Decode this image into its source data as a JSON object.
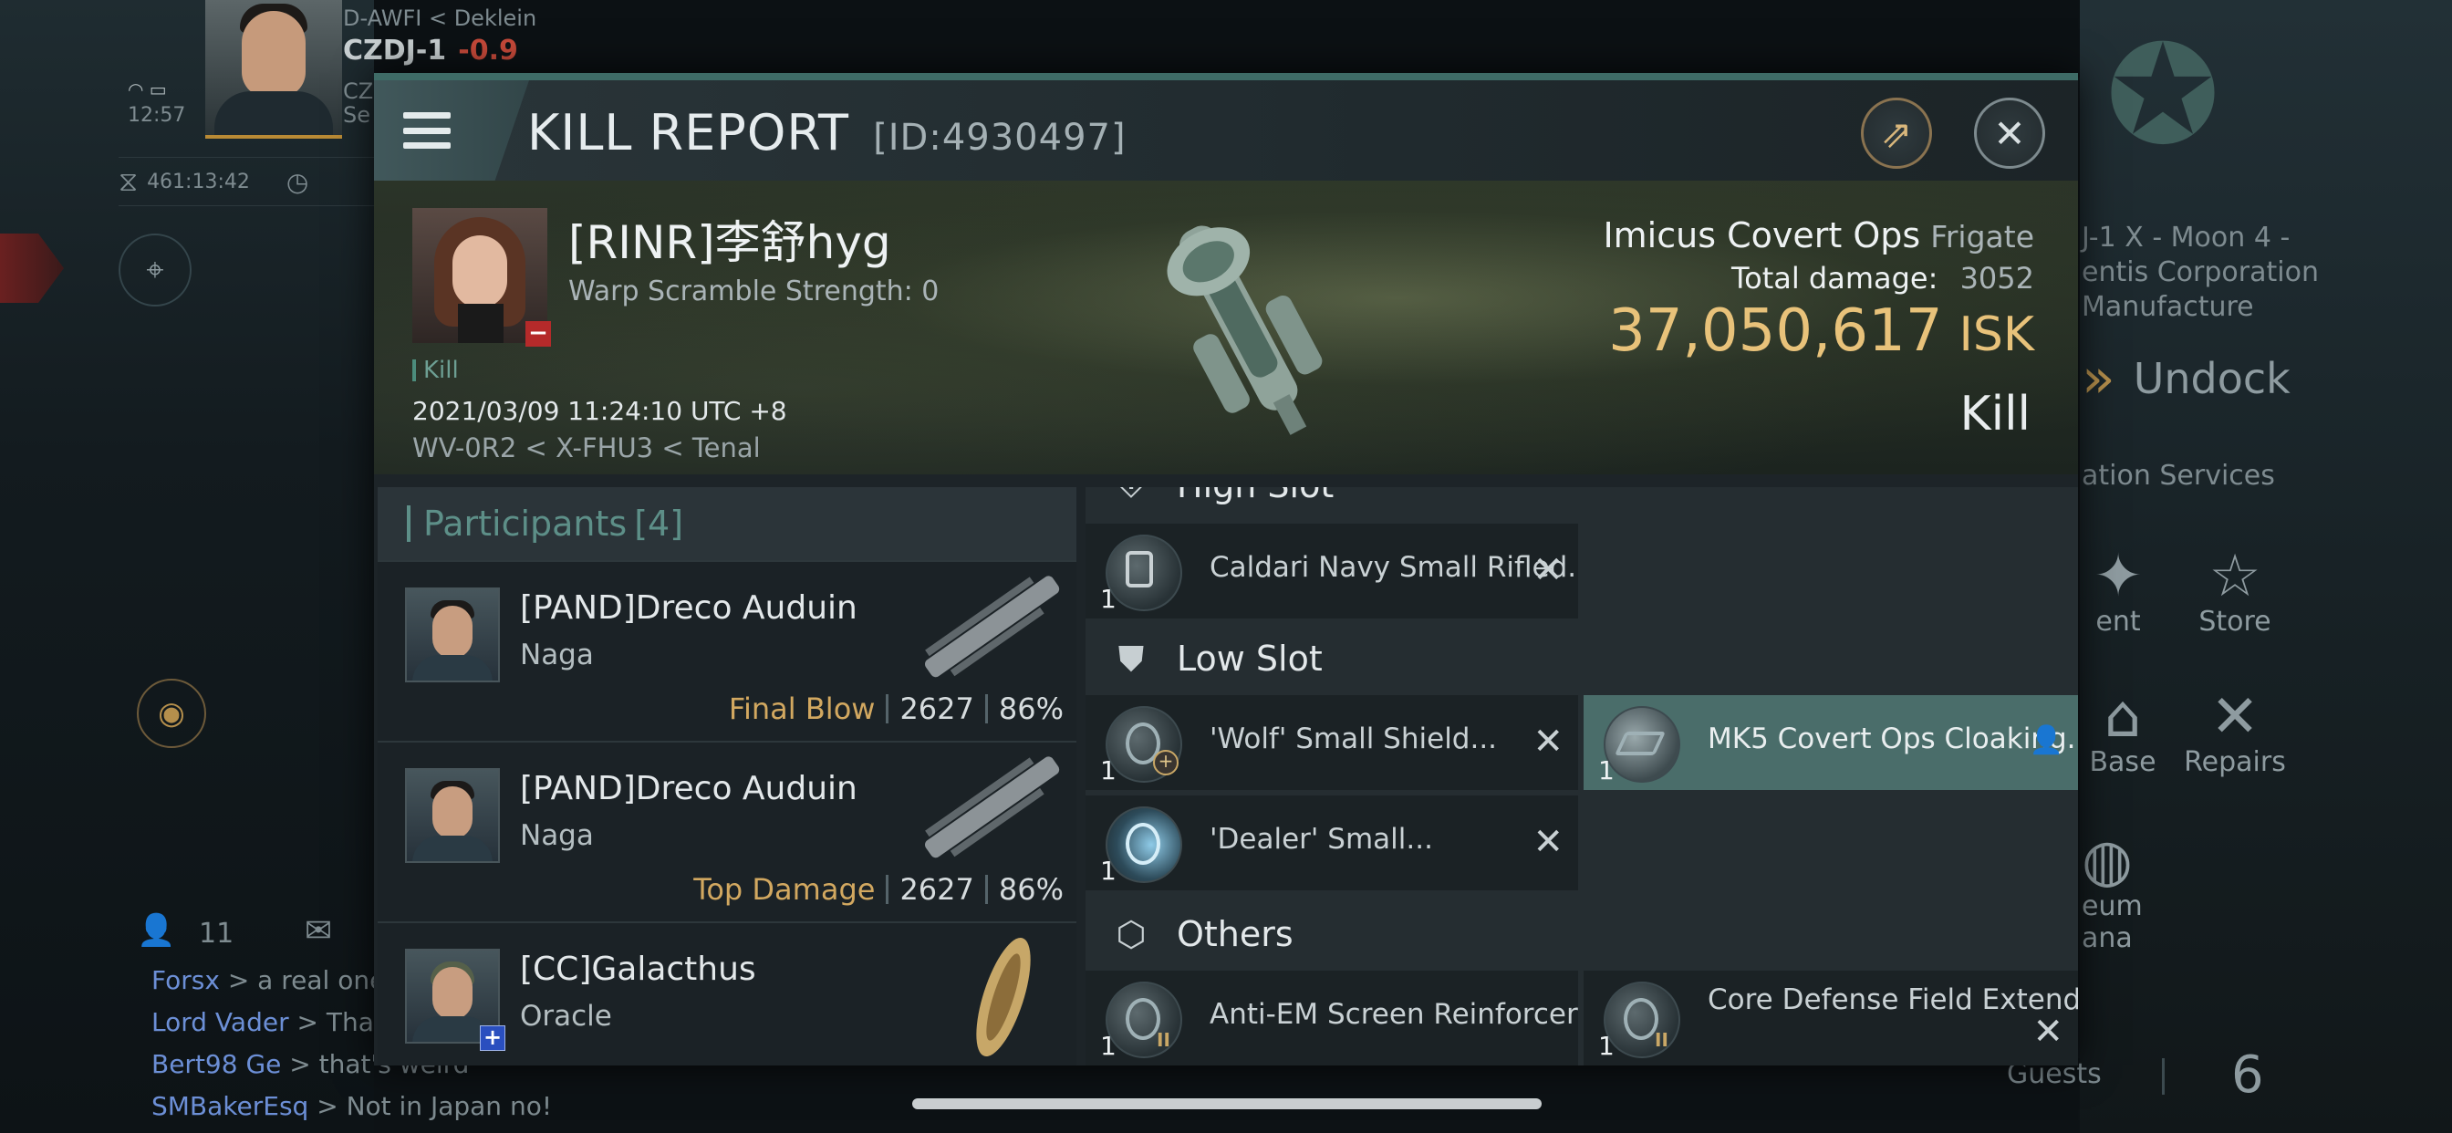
{
  "background": {
    "topleft": {
      "system_path": "D-AWFI < Deklein",
      "system": "CZDJ-1",
      "security": "-0.9",
      "time": "12:57",
      "line2_prefix": "CZI",
      "line3_prefix": "Se",
      "skill_timer": "461:13:42"
    },
    "chat": {
      "member_count": "11",
      "lines": [
        {
          "name": "Forsx",
          "msg": " > a real one"
        },
        {
          "name": "Lord Vader",
          "msg": " > That"
        },
        {
          "name": "Bert98 Ge",
          "msg": " > that's weird"
        },
        {
          "name": "SMBakerEsq",
          "msg": " > Not in Japan no!"
        }
      ]
    },
    "station": {
      "location_line1": "J-1 X - Moon 4 -",
      "location_line2": "entis Corporation",
      "location_line3": "Manufacture",
      "undock_label": "Undock",
      "services_label": "ation Services",
      "menu": [
        {
          "label": "ent"
        },
        {
          "label": "Store"
        },
        {
          "label": "Base"
        },
        {
          "label": "Repairs"
        },
        {
          "label": "eum"
        },
        {
          "label": "ana"
        }
      ],
      "guests_label": "Guests",
      "guests_count": "6"
    }
  },
  "dialog": {
    "title": "KILL REPORT",
    "id_label": "[ID:4930497]",
    "victim": {
      "name": "[RINR]李舒hyg",
      "warp_scramble": "Warp Scramble Strength: 0",
      "tag": "Kill",
      "datetime": "2021/03/09 11:24:10 UTC +8",
      "location": "WV-0R2 < X-FHU3 < Tenal"
    },
    "ship": {
      "name": "Imicus Covert Ops",
      "class": "Frigate",
      "damage_label": "Total damage:",
      "damage_value": "3052",
      "isk_value": "37,050,617",
      "isk_unit": "ISK",
      "result": "Kill"
    },
    "participants": {
      "title": "Participants",
      "count": "[4]",
      "rows": [
        {
          "name": "[PAND]Dreco Auduin",
          "ship": "Naga",
          "tag": "Final Blow",
          "damage": "2627",
          "percent": "86%"
        },
        {
          "name": "[PAND]Dreco Auduin",
          "ship": "Naga",
          "tag": "Top Damage",
          "damage": "2627",
          "percent": "86%"
        },
        {
          "name": "[CC]Galacthus",
          "ship": "Oracle",
          "tag": "",
          "damage": "",
          "percent": ""
        }
      ]
    },
    "fitting": {
      "high_slot_label": "High Slot",
      "high_modules": [
        {
          "name": "Caldari Navy Small Rifled...",
          "qty": "1"
        }
      ],
      "low_slot_label": "Low Slot",
      "low_modules": [
        {
          "name": "'Wolf' Small Shield...",
          "qty": "1"
        },
        {
          "name": "MK5 Covert Ops Cloaking...",
          "qty": "1"
        },
        {
          "name": "'Dealer' Small...",
          "qty": "1"
        }
      ],
      "others_label": "Others",
      "other_modules": [
        {
          "name": "Anti-EM Screen Reinforcer II",
          "qty": "1"
        },
        {
          "name": "Core Defense Field Extende...",
          "qty": "1"
        }
      ]
    }
  },
  "colors": {
    "accent_teal": "#3e6b66",
    "isk_gold": "#e8c27a",
    "tag_gold": "#d2a860",
    "victim_badge_red": "#b52a2a"
  }
}
